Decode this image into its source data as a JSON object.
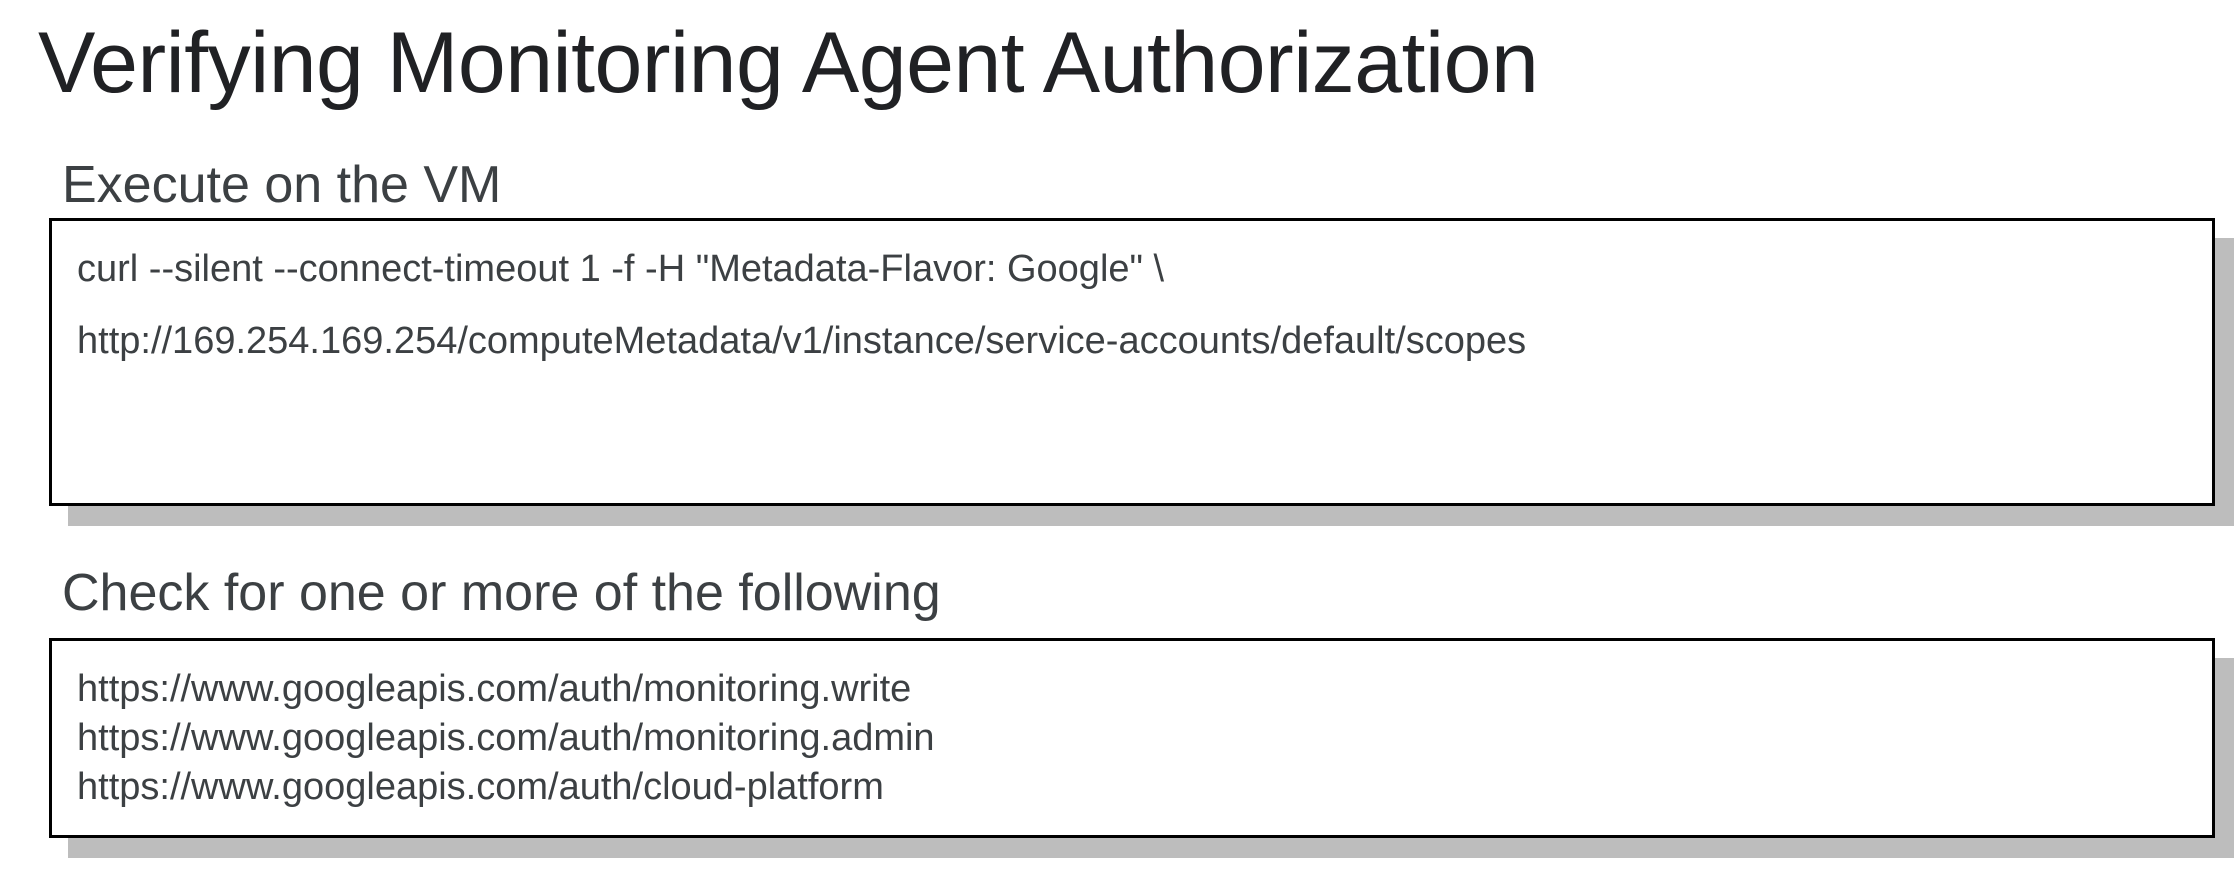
{
  "title": "Verifying Monitoring Agent Authorization",
  "execute_section": {
    "heading": "Execute on the VM",
    "command_lines": [
      "curl --silent --connect-timeout 1 -f -H \"Metadata-Flavor: Google\" \\",
      "http://169.254.169.254/computeMetadata/v1/instance/service-accounts/default/scopes"
    ]
  },
  "check_section": {
    "heading": "Check for one or more of the following",
    "scopes": [
      "https://www.googleapis.com/auth/monitoring.write",
      "https://www.googleapis.com/auth/monitoring.admin",
      "https://www.googleapis.com/auth/cloud-platform"
    ]
  }
}
